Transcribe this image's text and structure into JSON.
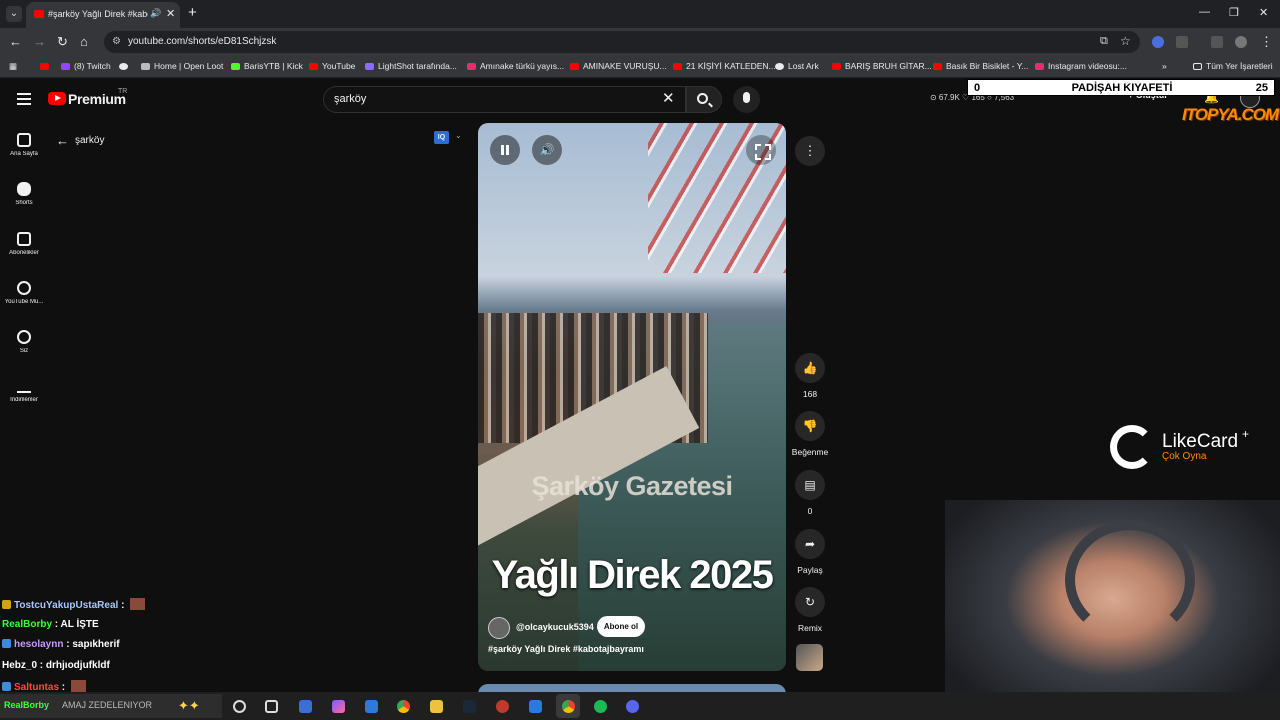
{
  "browser": {
    "tab_title": "#şarköy Yağlı Direk #kabotajbayramı",
    "url": "youtube.com/shorts/eD81Schjzsk",
    "bookmarks": [
      {
        "label": "(8) Twitch",
        "color": "#9146ff"
      },
      {
        "label": "",
        "color": "#e8eaed"
      },
      {
        "label": "Home | Open Loot",
        "color": "#e8eaed"
      },
      {
        "label": "BarisYTB | Kick",
        "color": "#53fc18"
      },
      {
        "label": "YouTube",
        "color": "#ff0000"
      },
      {
        "label": "LightShot tarafında...",
        "color": "#8e6bff"
      },
      {
        "label": "Amınake türkü yayıs...",
        "color": "#e1306c"
      },
      {
        "label": "AMINAKE VURUŞU...",
        "color": "#ff0000"
      },
      {
        "label": "21 KİŞİYİ KATLEDEN...",
        "color": "#ff0000"
      },
      {
        "label": "Lost Ark",
        "color": "#e8eaed"
      },
      {
        "label": "BARIŞ BRUH GİTAR...",
        "color": "#ff0000"
      },
      {
        "label": "Basık Bir Bisiklet - Y...",
        "color": "#ff0000"
      },
      {
        "label": "Instagram videosu:...",
        "color": "#e1306c"
      }
    ],
    "all_bookmarks_label": "Tüm Yer İşaretleri"
  },
  "youtube": {
    "logo_text": "Premium",
    "logo_region": "TR",
    "search_value": "şarköy",
    "sidebar": [
      {
        "label": "Ana Sayfa",
        "icon": "home-icon"
      },
      {
        "label": "Shorts",
        "icon": "shorts-icon"
      },
      {
        "label": "Abonelikler",
        "icon": "subscriptions-icon"
      },
      {
        "label": "YouTube Mu...",
        "icon": "youtube-music-icon"
      },
      {
        "label": "Siz",
        "icon": "you-icon"
      },
      {
        "label": "İndirilenler",
        "icon": "download-icon"
      }
    ],
    "back_label": "şarköy",
    "iq_badge": "IQ",
    "header_stats": "⊙ 67.9K  ♡ 165  ○ 7,563",
    "create_label": "Oluştur",
    "video": {
      "watermark": "Şarköy Gazetesi",
      "headline": "Yağlı Direk 2025",
      "channel": "@olcaykucuk5394",
      "subscribe": "Abone ol",
      "title": "#şarköy Yağlı Direk #kabotajbayramı"
    },
    "actions": {
      "likes": "168",
      "dislike_label": "Beğenme",
      "comments": "0",
      "share_label": "Paylaş",
      "remix_label": "Remix"
    }
  },
  "overlay": {
    "score_left": "0",
    "score_title": "PADİŞAH KIYAFETİ",
    "score_right": "25",
    "orange_logo": "ITOPYA.COM",
    "likecard_name": "LikeCard",
    "likecard_slogan": "Çok Oyna"
  },
  "chat": [
    {
      "user": "TostcuYakupUstaReal",
      "color": "#a8c8ff",
      "msg": "",
      "emote": true,
      "badge": "#d4a017"
    },
    {
      "user": "RealBorby",
      "color": "#3cff3c",
      "msg": "AL İŞTE",
      "emote": false,
      "badge": ""
    },
    {
      "user": "hesolaynn",
      "color": "#c89aff",
      "msg": "sapıkherif",
      "emote": false,
      "badge": "#3a8dde"
    },
    {
      "user": "Hebz_0",
      "color": "#ffffff",
      "msg": "drhjıodjufkldf",
      "emote": false,
      "badge": ""
    },
    {
      "user": "Saltuntas",
      "color": "#ff4a4a",
      "msg": "",
      "emote": true,
      "badge": "#3a8dde"
    }
  ],
  "taskbar": {
    "search_text": "AMAJ ZEDELENIYOR",
    "search_user": "RealBorby"
  }
}
